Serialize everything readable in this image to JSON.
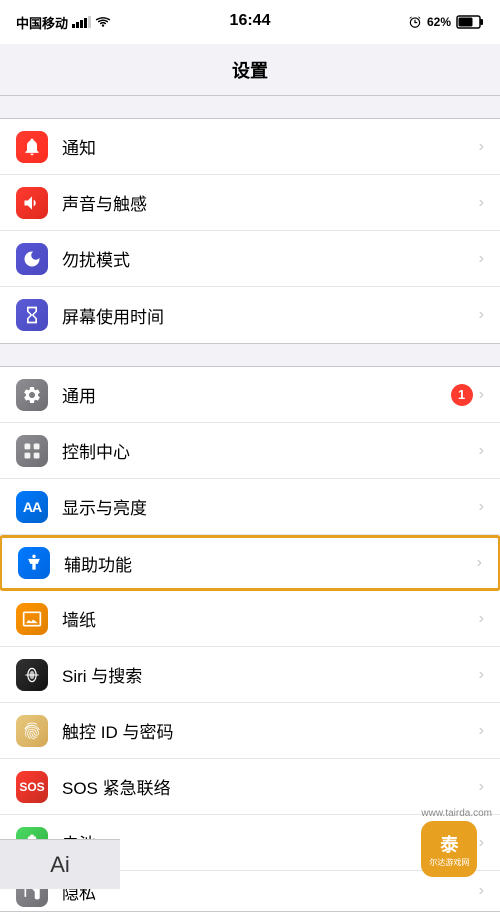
{
  "statusBar": {
    "carrier": "中国移动",
    "time": "16:44",
    "battery": "62%"
  },
  "navBar": {
    "title": "设置"
  },
  "sections": [
    {
      "id": "section1",
      "items": [
        {
          "id": "tongzhi",
          "label": "通知",
          "iconClass": "icon-tongzhi",
          "iconType": "bell",
          "badge": null,
          "highlighted": false
        },
        {
          "id": "shengyin",
          "label": "声音与触感",
          "iconClass": "icon-shengyin",
          "iconType": "sound",
          "badge": null,
          "highlighted": false
        },
        {
          "id": "wufang",
          "label": "勿扰模式",
          "iconClass": "icon-wufang",
          "iconType": "moon",
          "badge": null,
          "highlighted": false
        },
        {
          "id": "pingmu",
          "label": "屏幕使用时间",
          "iconClass": "icon-pingmu",
          "iconType": "hourglass",
          "badge": null,
          "highlighted": false
        }
      ]
    },
    {
      "id": "section2",
      "items": [
        {
          "id": "tongyong",
          "label": "通用",
          "iconClass": "icon-tongyong",
          "iconType": "gear",
          "badge": "1",
          "highlighted": false
        },
        {
          "id": "kongzhi",
          "label": "控制中心",
          "iconClass": "icon-kongzhi",
          "iconType": "control",
          "badge": null,
          "highlighted": false
        },
        {
          "id": "xianshi",
          "label": "显示与亮度",
          "iconClass": "icon-xianshi",
          "iconType": "aa",
          "badge": null,
          "highlighted": false
        },
        {
          "id": "fuzhu",
          "label": "辅助功能",
          "iconClass": "icon-fuzhu",
          "iconType": "accessibility",
          "badge": null,
          "highlighted": true
        },
        {
          "id": "biezhi",
          "label": "墙纸",
          "iconClass": "icon-biezhi",
          "iconType": "wallpaper",
          "badge": null,
          "highlighted": false
        },
        {
          "id": "siri",
          "label": "Siri 与搜索",
          "iconClass": "icon-siri",
          "iconType": "siri",
          "badge": null,
          "highlighted": false
        },
        {
          "id": "zhiwen",
          "label": "触控 ID 与密码",
          "iconClass": "icon-zhiwen",
          "iconType": "fingerprint",
          "badge": null,
          "highlighted": false
        },
        {
          "id": "sos",
          "label": "SOS 紧急联络",
          "iconClass": "icon-sos",
          "iconType": "sos",
          "badge": null,
          "highlighted": false
        },
        {
          "id": "diandian",
          "label": "电池",
          "iconClass": "icon-diandian",
          "iconType": "battery",
          "badge": null,
          "highlighted": false
        },
        {
          "id": "yinsi",
          "label": "隐私",
          "iconClass": "icon-yinsi",
          "iconType": "hand",
          "badge": null,
          "highlighted": false
        }
      ]
    }
  ],
  "watermark": {
    "logoText": "泰",
    "siteUrl": "www.tairda.com",
    "aiText": "Ai"
  }
}
